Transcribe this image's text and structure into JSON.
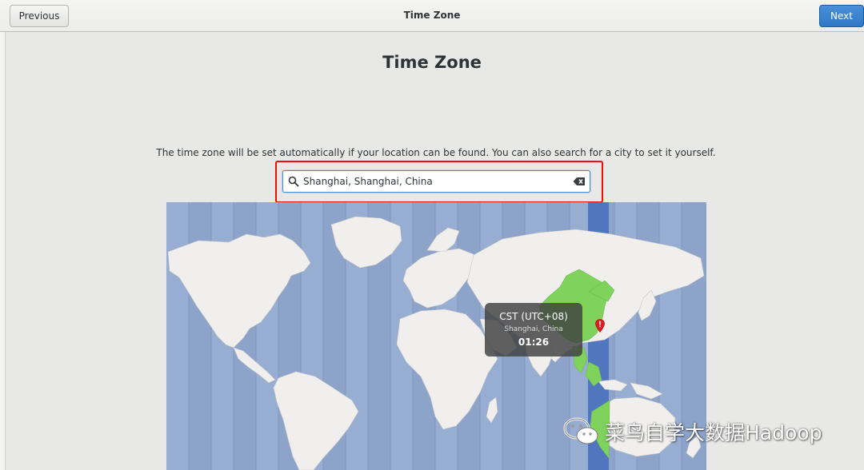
{
  "window": {
    "title": "Time Zone",
    "previous_label": "Previous",
    "next_label": "Next"
  },
  "page": {
    "heading": "Time Zone",
    "description": "The time zone will be set automatically if your location can be found. You can also search for a city to set it yourself."
  },
  "search": {
    "value": "Shanghai, Shanghai, China"
  },
  "map": {
    "selected_region_color": "#7fd35c",
    "ocean_color": "#8da3c9",
    "land_color": "#f0efee",
    "highlight_band_color": "#4f76bf"
  },
  "tooltip": {
    "timezone": "CST (UTC+08)",
    "city": "Shanghai, China",
    "time": "01:26"
  },
  "watermark": {
    "text": "菜鸟自学大数据Hadoop"
  },
  "colors": {
    "accent": "#4a90d9",
    "highlight_box": "#e8120c"
  }
}
